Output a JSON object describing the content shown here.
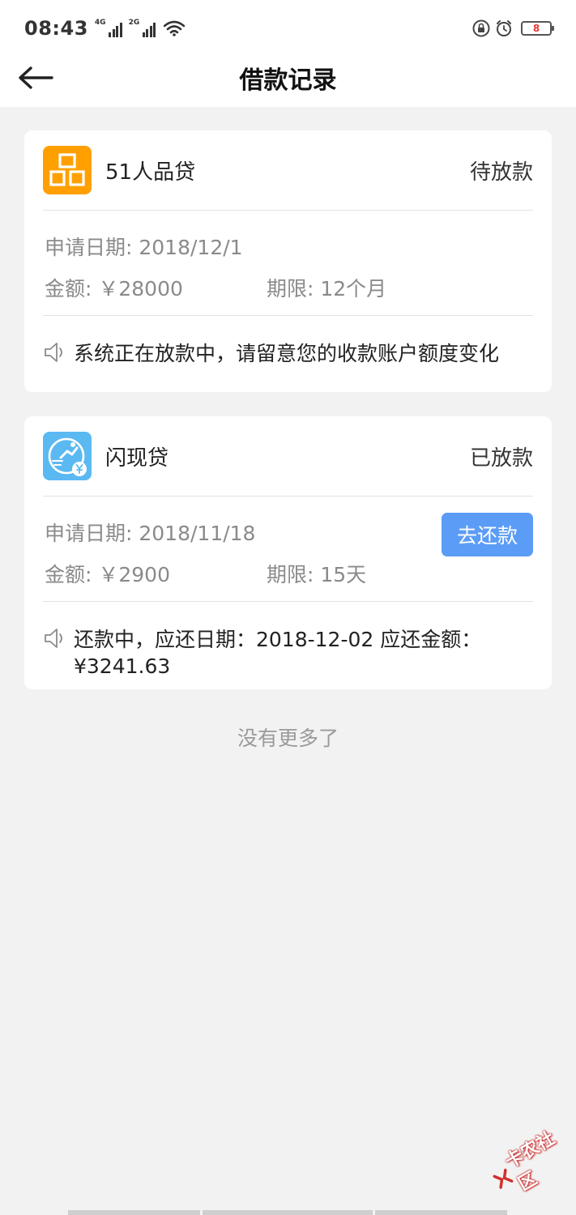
{
  "status_bar": {
    "time": "08:43",
    "net1": "4G",
    "net2": "2G",
    "battery": "8",
    "battery_color": "#e53935"
  },
  "nav": {
    "title": "借款记录",
    "back_icon": "arrow-left-icon"
  },
  "loans": [
    {
      "name": "51人品贷",
      "status": "待放款",
      "logo_char": "品",
      "logo_color": "#ffa000",
      "date_text": "申请日期: 2018/12/1",
      "amount_text": "金额: ￥28000",
      "term_text": "期限: 12个月",
      "note": "系统正在放款中，请留意您的收款账户额度变化"
    },
    {
      "name": "闪现贷",
      "status": "已放款",
      "logo_color": "#5bb9f2",
      "date_text": "申请日期: 2018/11/18",
      "amount_text": "金额: ￥2900",
      "term_text": "期限: 15天",
      "action_label": "去还款",
      "note_line1": "还款中，应还日期：2018-12-02 应还金额：",
      "note_line2": "¥3241.63"
    }
  ],
  "footer": {
    "no_more": "没有更多了"
  },
  "watermark": {
    "text": "卡农社区"
  },
  "accent_color": "#5b9cf6"
}
